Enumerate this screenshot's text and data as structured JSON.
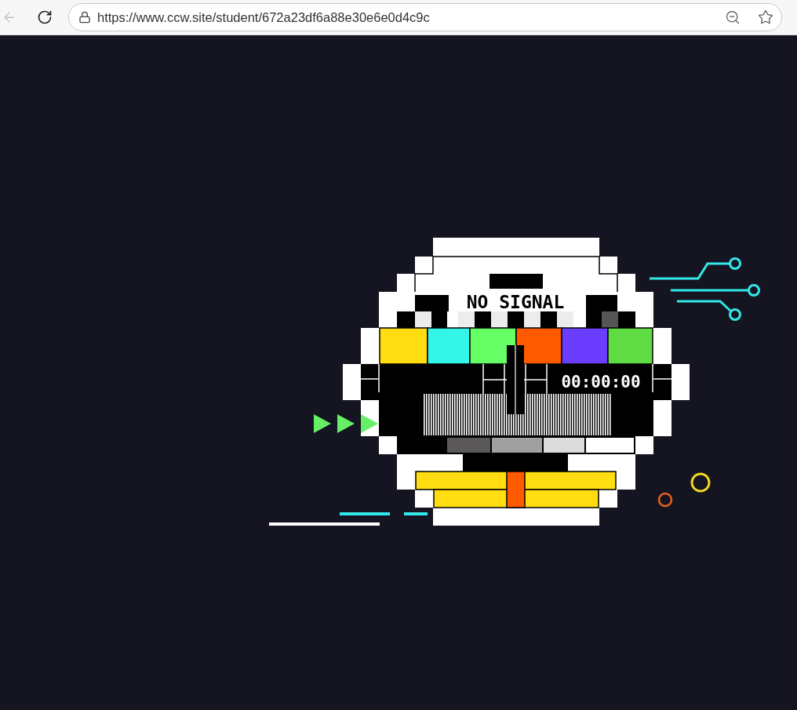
{
  "browser": {
    "url": "https://www.ccw.site/student/672a23df6a88e30e6e0d4c9c"
  },
  "screen": {
    "title": "NO SIGNAL",
    "timer": "00:00:00"
  }
}
